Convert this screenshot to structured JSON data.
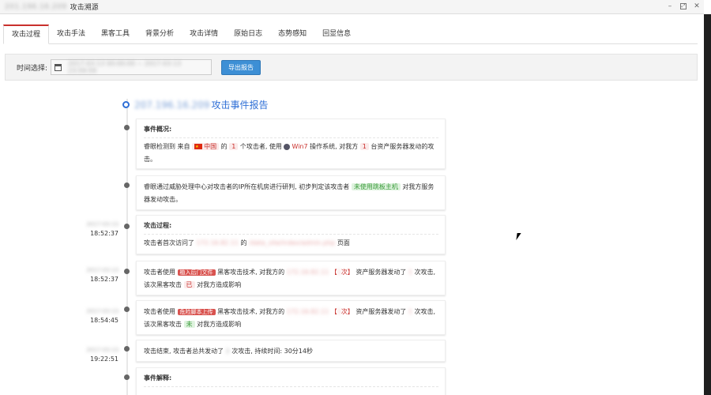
{
  "window": {
    "ip": "201.196.16.209",
    "title": "攻击溯源"
  },
  "tabs": [
    {
      "label": "攻击过程"
    },
    {
      "label": "攻击手法"
    },
    {
      "label": "黑客工具"
    },
    {
      "label": "背景分析"
    },
    {
      "label": "攻击详情"
    },
    {
      "label": "原始日志"
    },
    {
      "label": "态势感知"
    },
    {
      "label": "回显信息"
    }
  ],
  "filter": {
    "label": "时间选择:",
    "date_range": "2017-03-13 00:00:00 ~ 2017-03-13 23:59:59",
    "export_label": "导出报告"
  },
  "report": {
    "ip": "207.196.16.209",
    "title": "攻击事件报告"
  },
  "overview": {
    "title": "事件概况:",
    "t1": "睿眼检测到 来自",
    "country": "中国",
    "t2": "的",
    "attacker_count": "1",
    "t3": "个攻击者, 使用",
    "os": "Win7",
    "t4": "操作系统, 对我方",
    "asset_count": "1",
    "t5": "台资产服务器发动的攻击。"
  },
  "intel": {
    "t1": "睿眼通过威胁处理中心对攻击者的IP所在机房进行研判, 初步判定该攻击者",
    "tag": "未使用跳板主机",
    "t2": "对我方服务器发动攻击。"
  },
  "process": {
    "title": "攻击过程:",
    "date": "2017-03-13",
    "time": "18:52:37",
    "t1": "攻击者首次访问了",
    "ip": "172.16.82.11",
    "t2": "的",
    "url": "/data_site/index/admin.php",
    "t3": "页面"
  },
  "event1": {
    "date": "2017-03-13",
    "time": "18:52:37",
    "t1": "攻击者使用",
    "badge": "植入后门文件",
    "t2": "黑客攻击技术, 对我方的",
    "ip": "172.16.82.11",
    "count_open": "【",
    "count_blur": "1",
    "count_close": "次】",
    "t3": "资产服务器发动了",
    "times": "1",
    "t4": "次攻击, 该次黑客攻击",
    "result": "已",
    "t5": "对我方造成影响"
  },
  "event2": {
    "date": "2017-03-13",
    "time": "18:54:45",
    "t1": "攻击者使用",
    "badge": "危险脚本上传",
    "t2": "黑客攻击技术, 对我方的",
    "ip": "172.16.82.11",
    "count_open": "【",
    "count_blur": "1",
    "count_close": "次】",
    "t3": "资产服务器发动了",
    "times": "1",
    "t4": "次攻击, 该次黑客攻击",
    "result": "未",
    "t5": "对我方造成影响"
  },
  "end": {
    "date": "2017-03-13",
    "time": "19:22:51",
    "t1": "攻击结束, 攻击者总共发动了",
    "total": "2",
    "t2": "次攻击, 持续时间: 30分14秒"
  },
  "explain": {
    "title": "事件解释:"
  }
}
